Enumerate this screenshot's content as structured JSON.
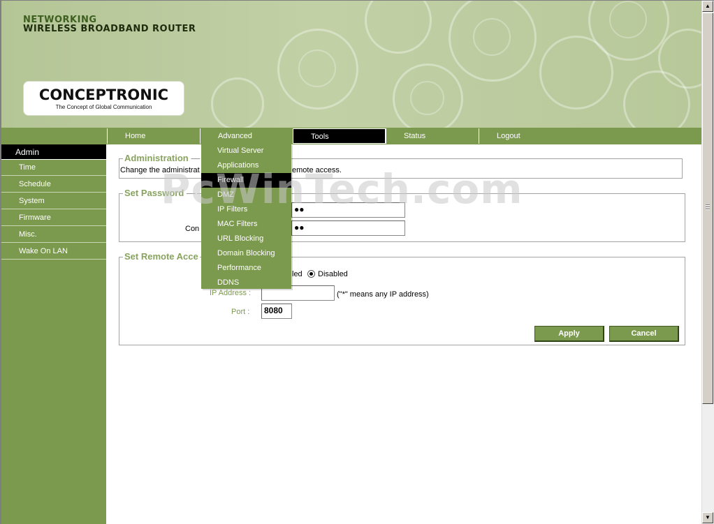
{
  "header": {
    "line1": "NETWORKING",
    "line2": "WIRELESS BROADBAND ROUTER",
    "logo": "CONCEPTRONIC",
    "tagline": "The Concept of Global Communication"
  },
  "nav": {
    "tabs": [
      {
        "label": "Home"
      },
      {
        "label": "Advanced"
      },
      {
        "label": "Tools"
      },
      {
        "label": "Status"
      },
      {
        "label": "Logout"
      }
    ],
    "active": "Tools"
  },
  "sidebar": {
    "items": [
      {
        "label": "Admin"
      },
      {
        "label": "Time"
      },
      {
        "label": "Schedule"
      },
      {
        "label": "System"
      },
      {
        "label": "Firmware"
      },
      {
        "label": "Misc."
      },
      {
        "label": "Wake On LAN"
      }
    ],
    "active": "Admin"
  },
  "advanced_menu": {
    "items": [
      {
        "label": "Virtual Server"
      },
      {
        "label": "Applications"
      },
      {
        "label": "Firewall"
      },
      {
        "label": "DMZ"
      },
      {
        "label": "IP Filters"
      },
      {
        "label": "MAC Filters"
      },
      {
        "label": "URL Blocking"
      },
      {
        "label": "Domain Blocking"
      },
      {
        "label": "Performance"
      },
      {
        "label": "DDNS"
      }
    ],
    "highlighted": "Firewall"
  },
  "administration": {
    "title": "Administration",
    "desc_left": "Change the administrat",
    "desc_right": "emote access."
  },
  "set_password": {
    "title": "Set Password",
    "confirm_label": "Con",
    "password_value": "●●",
    "confirm_value": "●●"
  },
  "remote_access": {
    "title": "Set Remote Acce",
    "enabled_fragment": "led",
    "disabled_label": "Disabled",
    "disabled_selected": true,
    "ip_label": "IP Address :",
    "ip_value": "",
    "ip_hint": "(\"*\" means any IP address)",
    "port_label": "Port :",
    "port_value": "8080"
  },
  "buttons": {
    "apply": "Apply",
    "cancel": "Cancel"
  },
  "watermark": "PcWinTech.com",
  "scrollbar": {
    "up": "▲",
    "down": "▼"
  },
  "colors": {
    "accent": "#7c9a4e",
    "title_green": "#88a35e",
    "nav_active": "#000000"
  }
}
